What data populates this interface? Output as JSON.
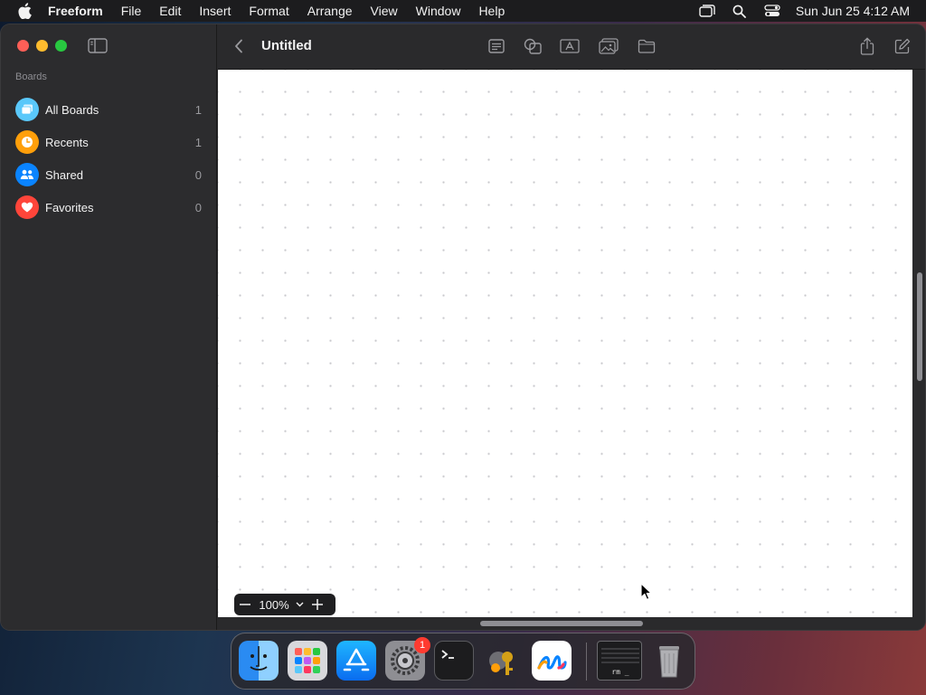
{
  "menubar": {
    "app_name": "Freeform",
    "items": [
      "File",
      "Edit",
      "Insert",
      "Format",
      "Arrange",
      "View",
      "Window",
      "Help"
    ],
    "clock": "Sun Jun 25  4:12 AM",
    "status_icons": [
      "screen-mirroring-icon",
      "spotlight-search-icon",
      "control-center-icon"
    ]
  },
  "sidebar": {
    "section_label": "Boards",
    "items": [
      {
        "label": "All Boards",
        "count": "1",
        "icon": "boards-icon",
        "color": "#5ac8fa"
      },
      {
        "label": "Recents",
        "count": "1",
        "icon": "clock-icon",
        "color": "#ff9f0a"
      },
      {
        "label": "Shared",
        "count": "0",
        "icon": "people-icon",
        "color": "#0a84ff"
      },
      {
        "label": "Favorites",
        "count": "0",
        "icon": "heart-icon",
        "color": "#ff453a"
      }
    ]
  },
  "toolbar": {
    "title": "Untitled",
    "tools": [
      "sticky-note-icon",
      "shapes-icon",
      "text-box-icon",
      "media-icon",
      "file-icon"
    ],
    "actions": [
      "share-icon",
      "new-board-icon"
    ]
  },
  "zoom": {
    "level": "100%"
  },
  "dock": {
    "apps": [
      "Finder",
      "Launchpad",
      "App Store",
      "System Settings",
      "Terminal",
      "Keychain Access",
      "Freeform"
    ],
    "settings_badge": "1",
    "terminal_preview_label": "rm _",
    "trash": "Trash"
  },
  "colors": {
    "accent": "#0a84ff",
    "canvas_bg": "#ffffff",
    "sidebar_bg": "#2c2c2e"
  }
}
